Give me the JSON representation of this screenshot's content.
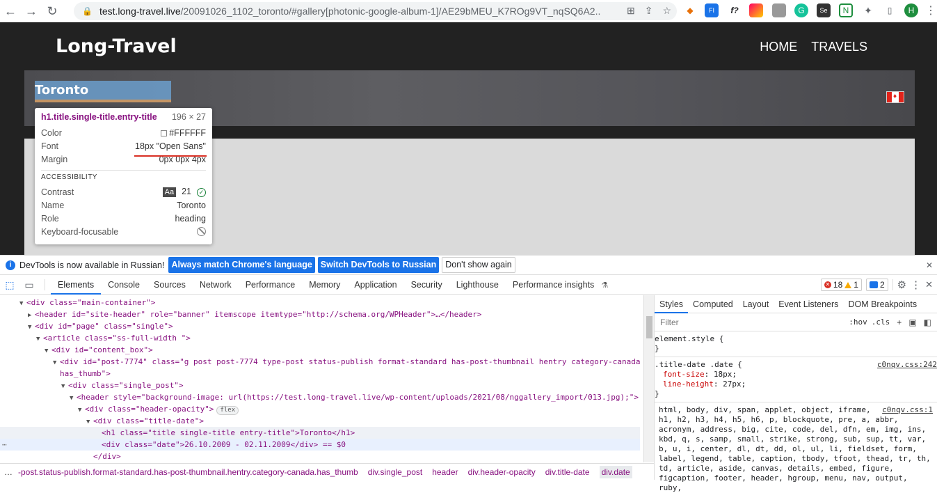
{
  "browser": {
    "url_host": "test.long-travel.live",
    "url_path": "/20091026_1102_toronto/#gallery[photonic-google-album-1]/AE29bMEU_K7ROg9VT_nqSQ6A2...",
    "profile_initial": "H"
  },
  "site": {
    "title": "Long-Travel",
    "nav": [
      "HOME",
      "TRAVELS"
    ],
    "hero_title": "Toronto"
  },
  "tooltip": {
    "selector": "h1.title.single-title.entry-title",
    "dimensions": "196 × 27",
    "rows": [
      {
        "k": "Color",
        "v": "#FFFFFF"
      },
      {
        "k": "Font",
        "v": "18px \"Open Sans\""
      },
      {
        "k": "Margin",
        "v": "0px 0px 4px"
      }
    ],
    "accessibility_label": "ACCESSIBILITY",
    "contrast_label": "Contrast",
    "contrast_aa": "Aa",
    "contrast_value": "21",
    "name_label": "Name",
    "name_value": "Toronto",
    "role_label": "Role",
    "role_value": "heading",
    "kbd_label": "Keyboard-focusable"
  },
  "infobar": {
    "message": "DevTools is now available in Russian!",
    "btn1": "Always match Chrome's language",
    "btn2": "Switch DevTools to Russian",
    "btn3": "Don't show again"
  },
  "devtools": {
    "tabs": [
      "Elements",
      "Console",
      "Sources",
      "Network",
      "Performance",
      "Memory",
      "Application",
      "Security",
      "Lighthouse",
      "Performance insights"
    ],
    "errors": "18",
    "warnings": "1",
    "messages": "2"
  },
  "dom": [
    {
      "indent": 28,
      "arrow": "▼",
      "html": "main"
    },
    {
      "indent": 40,
      "arrow": "▶",
      "html": "header"
    },
    {
      "indent": 40,
      "arrow": "▼",
      "html": "page"
    },
    {
      "indent": 52,
      "arrow": "▼",
      "html": "article"
    },
    {
      "indent": 64,
      "arrow": "▼",
      "html": "content_box"
    },
    {
      "indent": 76,
      "arrow": "▼",
      "html": "post"
    },
    {
      "indent": 86,
      "arrow": "",
      "html": "post2"
    },
    {
      "indent": 88,
      "arrow": "▼",
      "html": "single_post"
    },
    {
      "indent": 100,
      "arrow": "▼",
      "html": "header2"
    },
    {
      "indent": 112,
      "arrow": "▼",
      "html": "header_opacity"
    },
    {
      "indent": 124,
      "arrow": "▼",
      "html": "title_date"
    },
    {
      "indent": 146,
      "arrow": "",
      "html": "h1"
    },
    {
      "indent": 146,
      "arrow": "",
      "html": "date"
    },
    {
      "indent": 134,
      "arrow": "",
      "html": "closediv"
    }
  ],
  "dom_text": {
    "main_open": "<div class=\"main-container\">",
    "header_open": "<header id=\"site-header\" role=\"banner\" itemscope itemtype=\"http://schema.org/WPHeader\">…</header>",
    "page_open": "<div id=\"page\" class=\"single\">",
    "article_open": "<article class=\"ss-full-width \">",
    "content_open": "<div id=\"content_box\">",
    "post_open": "<div id=\"post-7774\" class=\"g post post-7774 type-post status-publish format-standard has-post-thumbnail hentry category-canada",
    "post_cont": "has_thumb\">",
    "single_open": "<div class=\"single_post\">",
    "header2_open": "<header style=\"background-image: url(https://test.long-travel.live/wp-content/uploads/2021/08/nggallery_import/013.jpg);\">",
    "opacity_open": "<div class=\"header-opacity\">",
    "flex_badge": "flex",
    "titledate_open": "<div class=\"title-date\">",
    "h1_line": "<h1 class=\"title single-title entry-title\">Toronto</h1>",
    "date_line": "<div class=\"date\">26.10.2009 - 02.11.2009</div> == $0",
    "close_div": "</div>"
  },
  "breadcrumbs": [
    "-post.status-publish.format-standard.has-post-thumbnail.hentry.category-canada.has_thumb",
    "div.single_post",
    "header",
    "div.header-opacity",
    "div.title-date",
    "div.date"
  ],
  "styles": {
    "tabs": [
      "Styles",
      "Computed",
      "Layout",
      "Event Listeners",
      "DOM Breakpoints"
    ],
    "filter_placeholder": "Filter",
    "hov": ":hov",
    "cls": ".cls",
    "element_style": "element.style {",
    "close": "}",
    "rule1_selector": ".title-date .date {",
    "rule1_src": "c0nqv.css:242",
    "rule1_p1": "font-size",
    "rule1_v1": "18px;",
    "rule1_p2": "line-height",
    "rule1_v2": "27px;",
    "rule2_src": "c0nqv.css:1",
    "rule2_lines": [
      "html, body, div, span, applet, object, iframe,",
      "h1, h2, h3, h4, h5, h6, p, blockquote, pre, a, abbr,",
      "acronym, address, big, cite, code, del, dfn, em, img, ins,",
      "kbd, q, s, samp, small, strike, strong, sub, sup, tt, var,",
      "b, u, i, center, dl, dt, dd, ol, ul, li, fieldset, form,",
      "label, legend, table, caption, tbody, tfoot, thead, tr, th,",
      "td, article, aside, canvas, details, embed, figure,",
      "figcaption, footer, header, hgroup, menu, nav, output, ruby,"
    ]
  }
}
